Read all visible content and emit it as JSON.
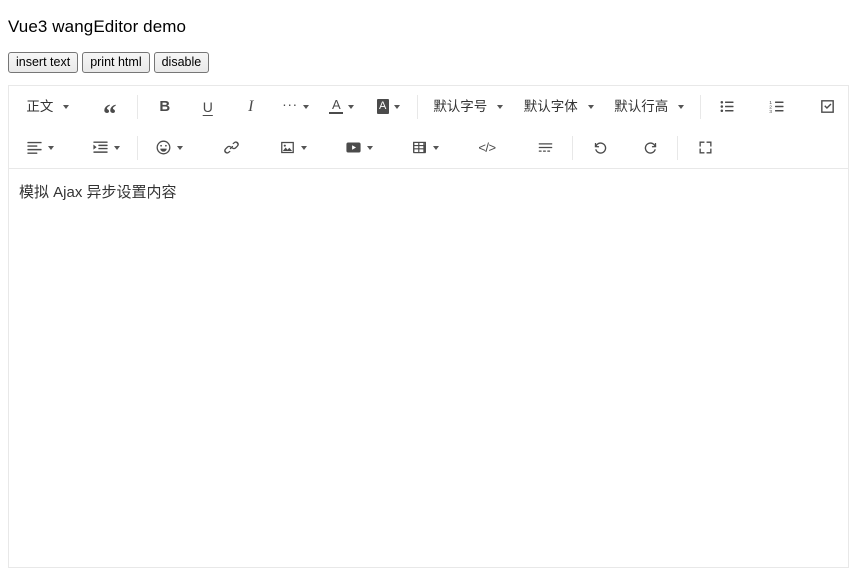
{
  "page": {
    "title": "Vue3 wangEditor demo"
  },
  "actions": [
    {
      "label": "insert text",
      "name": "insert-text-button"
    },
    {
      "label": "print html",
      "name": "print-html-button"
    },
    {
      "label": "disable",
      "name": "disable-button"
    }
  ],
  "toolbar": {
    "row1": {
      "header_select": "正文",
      "blockquote_icon": "blockquote-icon",
      "bold_label": "B",
      "underline_label": "U",
      "italic_label": "I",
      "more_label": "···",
      "font_color_label": "A",
      "bg_color_label": "A",
      "font_size_select": "默认字号",
      "font_family_select": "默认字体",
      "line_height_select": "默认行高",
      "bulleted_list_icon": "bulleted-list-icon",
      "numbered_list_icon": "numbered-list-icon",
      "todo_list_icon": "todo-list-icon"
    },
    "row2": {
      "align_icon": "text-align-icon",
      "indent_icon": "indent-icon",
      "emoji_icon": "emoji-icon",
      "link_icon": "link-icon",
      "image_icon": "image-icon",
      "video_icon": "video-icon",
      "table_icon": "table-icon",
      "code_block_label": "</>",
      "divider_icon": "horizontal-rule-icon",
      "undo_icon": "undo-icon",
      "redo_icon": "redo-icon",
      "fullscreen_icon": "fullscreen-icon"
    }
  },
  "editor": {
    "content": "模拟 Ajax 异步设置内容"
  },
  "colors": {
    "border": "#e8e8e8",
    "icon": "#4b4b4b",
    "text": "#333333",
    "button_face": "#efefef",
    "button_border": "#767676"
  }
}
